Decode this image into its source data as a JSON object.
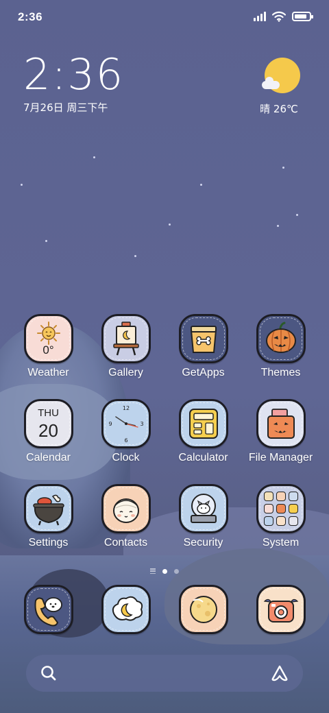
{
  "status_bar": {
    "time": "2:36",
    "battery_level": 0.85,
    "signal_bars": 4
  },
  "clock_widget": {
    "time": "2:36",
    "date": "7月26日 周三下午"
  },
  "weather_widget": {
    "text": "晴 26℃",
    "icon": "sun-cloud-icon"
  },
  "apps": [
    {
      "label": "Weather",
      "name": "weather",
      "icon_text": "0°"
    },
    {
      "label": "Gallery",
      "name": "gallery"
    },
    {
      "label": "GetApps",
      "name": "getapps"
    },
    {
      "label": "Themes",
      "name": "themes"
    },
    {
      "label": "Calendar",
      "name": "calendar",
      "icon_day": "THU",
      "icon_date": "20"
    },
    {
      "label": "Clock",
      "name": "clock"
    },
    {
      "label": "Calculator",
      "name": "calculator"
    },
    {
      "label": "File Manager",
      "name": "file-manager"
    },
    {
      "label": "Settings",
      "name": "settings"
    },
    {
      "label": "Contacts",
      "name": "contacts"
    },
    {
      "label": "Security",
      "name": "security"
    },
    {
      "label": "System",
      "name": "system"
    }
  ],
  "page_indicator": {
    "pages": 2,
    "current": 1
  },
  "dock": [
    {
      "name": "phone",
      "icon": "dog-phone-icon"
    },
    {
      "name": "messages",
      "icon": "moon-cloud-icon"
    },
    {
      "name": "browser",
      "icon": "moon-planet-icon"
    },
    {
      "name": "camera",
      "icon": "camera-icon"
    }
  ],
  "search_bar": {
    "icon": "search-icon",
    "assistant_icon": "assistant-icon"
  }
}
